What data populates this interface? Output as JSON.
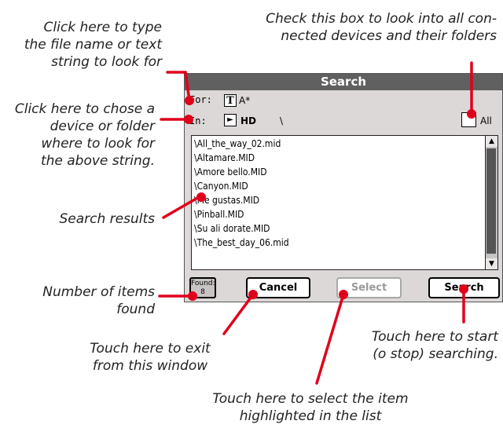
{
  "callouts": {
    "type_string": [
      "Click here to type",
      "the file name or text",
      "string to look for"
    ],
    "check_all": [
      "Check this box to look into all con-",
      "nected devices and their folders"
    ],
    "choose_device": [
      "Click here to chose a",
      "device or folder",
      "where to look for",
      "the above string."
    ],
    "results": [
      "Search results"
    ],
    "found_count": [
      "Number of items",
      "found"
    ],
    "exit": [
      "Touch here to exit",
      "from this window"
    ],
    "start": [
      "Touch here to start",
      "(o stop) searching."
    ],
    "select": [
      "Touch here to select the item",
      "highlighted in the list"
    ]
  },
  "window": {
    "title": "Search",
    "for_label": "For:",
    "for_icon": "T",
    "for_value": "A*",
    "in_label": "In:",
    "in_icon": "►",
    "in_device": "HD",
    "in_path": "\\",
    "all_label": "All",
    "all_checked": false,
    "results": [
      "\\All_the_way_02.mid",
      "\\Altamare.MID",
      "\\Amore bello.MID",
      "\\Canyon.MID",
      "\\Me gustas.MID",
      "\\Pinball.MID",
      "\\Su ali dorate.MID",
      "\\The_best_day_06.mid"
    ],
    "scroll_up": "▲",
    "scroll_down": "▼",
    "found_label": "Found:",
    "found_value": "8",
    "cancel_label": "Cancel",
    "select_label": "Select",
    "search_label": "Search"
  },
  "colors": {
    "accent": "#e0001b",
    "titlebar": "#606060"
  }
}
